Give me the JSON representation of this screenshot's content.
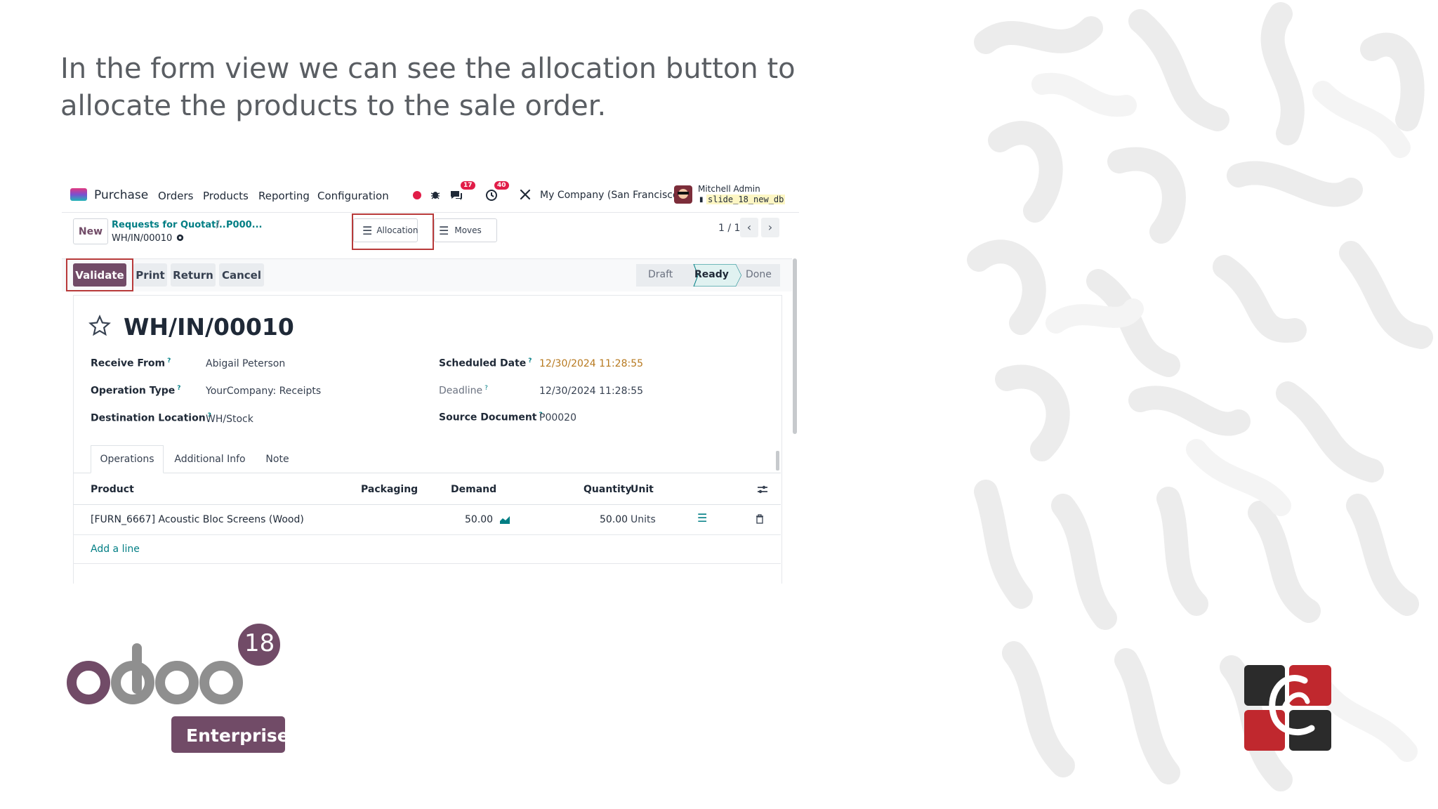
{
  "slide": {
    "caption": "In the form view we can see the allocation button to allocate the products to the sale order."
  },
  "colors": {
    "brand": "#714b67",
    "teal": "#017e84",
    "highlight": "#b83a3a",
    "deadline_orange": "#b7791f"
  },
  "navbar": {
    "app_name": "Purchase",
    "menu": [
      "Orders",
      "Products",
      "Reporting",
      "Configuration"
    ],
    "messages_badge": "17",
    "activities_badge": "40",
    "company": "My Company (San Francisco)",
    "user_name": "Mitchell Admin",
    "db_name": "slide_18_new_db"
  },
  "control": {
    "new_label": "New",
    "breadcrumb_parent": "Requests for Quotati...",
    "breadcrumb_sep": "/",
    "breadcrumb_current": "P000...",
    "record_name": "WH/IN/00010",
    "allocation_label": "Allocation",
    "moves_label": "Moves",
    "pager": "1 / 1"
  },
  "actions": {
    "validate": "Validate",
    "print": "Print",
    "return": "Return",
    "cancel": "Cancel"
  },
  "statusbar": [
    "Draft",
    "Ready",
    "Done"
  ],
  "form": {
    "title": "WH/IN/00010",
    "receive_from_label": "Receive From",
    "receive_from": "Abigail Peterson",
    "operation_type_label": "Operation Type",
    "operation_type": "YourCompany: Receipts",
    "destination_label": "Destination Location",
    "destination": "WH/Stock",
    "scheduled_date_label": "Scheduled Date",
    "scheduled_date": "12/30/2024 11:28:55",
    "deadline_label": "Deadline",
    "deadline": "12/30/2024 11:28:55",
    "source_document_label": "Source Document",
    "source_document": "P00020",
    "help_mark": "?"
  },
  "tabs": [
    "Operations",
    "Additional Info",
    "Note"
  ],
  "table": {
    "headers": {
      "product": "Product",
      "packaging": "Packaging",
      "demand": "Demand",
      "quantity": "Quantity",
      "unit": "Unit"
    },
    "rows": [
      {
        "product": "[FURN_6667] Acoustic Bloc Screens (Wood)",
        "packaging": "",
        "demand": "50.00",
        "quantity": "50.00",
        "unit": "Units"
      }
    ],
    "add_line": "Add a line"
  },
  "branding": {
    "odoo_version": "18",
    "odoo_edition": "Enterprise"
  }
}
